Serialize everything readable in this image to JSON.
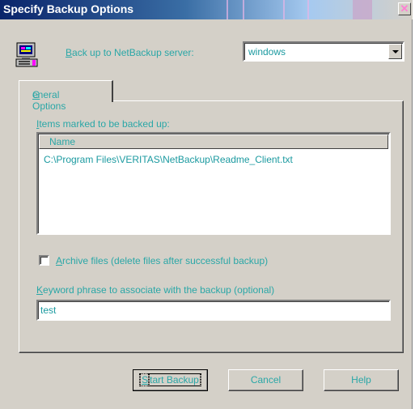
{
  "window": {
    "title": "Specify Backup Options",
    "close_glyph": "✕"
  },
  "server": {
    "label_accel": "B",
    "label_rest": "ack up to NetBackup server:",
    "selected": "windows"
  },
  "tabs": [
    {
      "accel": "G",
      "rest": "eneral Options"
    }
  ],
  "items": {
    "label_accel": "I",
    "label_rest": "tems marked to be backed up:",
    "column_header": "Name",
    "rows": [
      "C:\\Program Files\\VERITAS\\NetBackup\\Readme_Client.txt"
    ]
  },
  "archive": {
    "label_accel": "A",
    "label_rest": "rchive files (delete files after successful backup)",
    "checked": false
  },
  "keyword": {
    "label_accel": "K",
    "label_rest": "eyword phrase to associate with the backup (optional)",
    "value": "test"
  },
  "buttons": {
    "start_accel": "S",
    "start_rest": "tart Backup",
    "cancel": "Cancel",
    "help": "Help"
  },
  "colors": {
    "text": "#2aa7a7",
    "dialog_bg": "#d4d0c8",
    "title_bar": "#0a246a"
  },
  "icons": {
    "app": "computer-backup-icon",
    "close": "close-icon",
    "dropdown": "chevron-down-icon"
  }
}
